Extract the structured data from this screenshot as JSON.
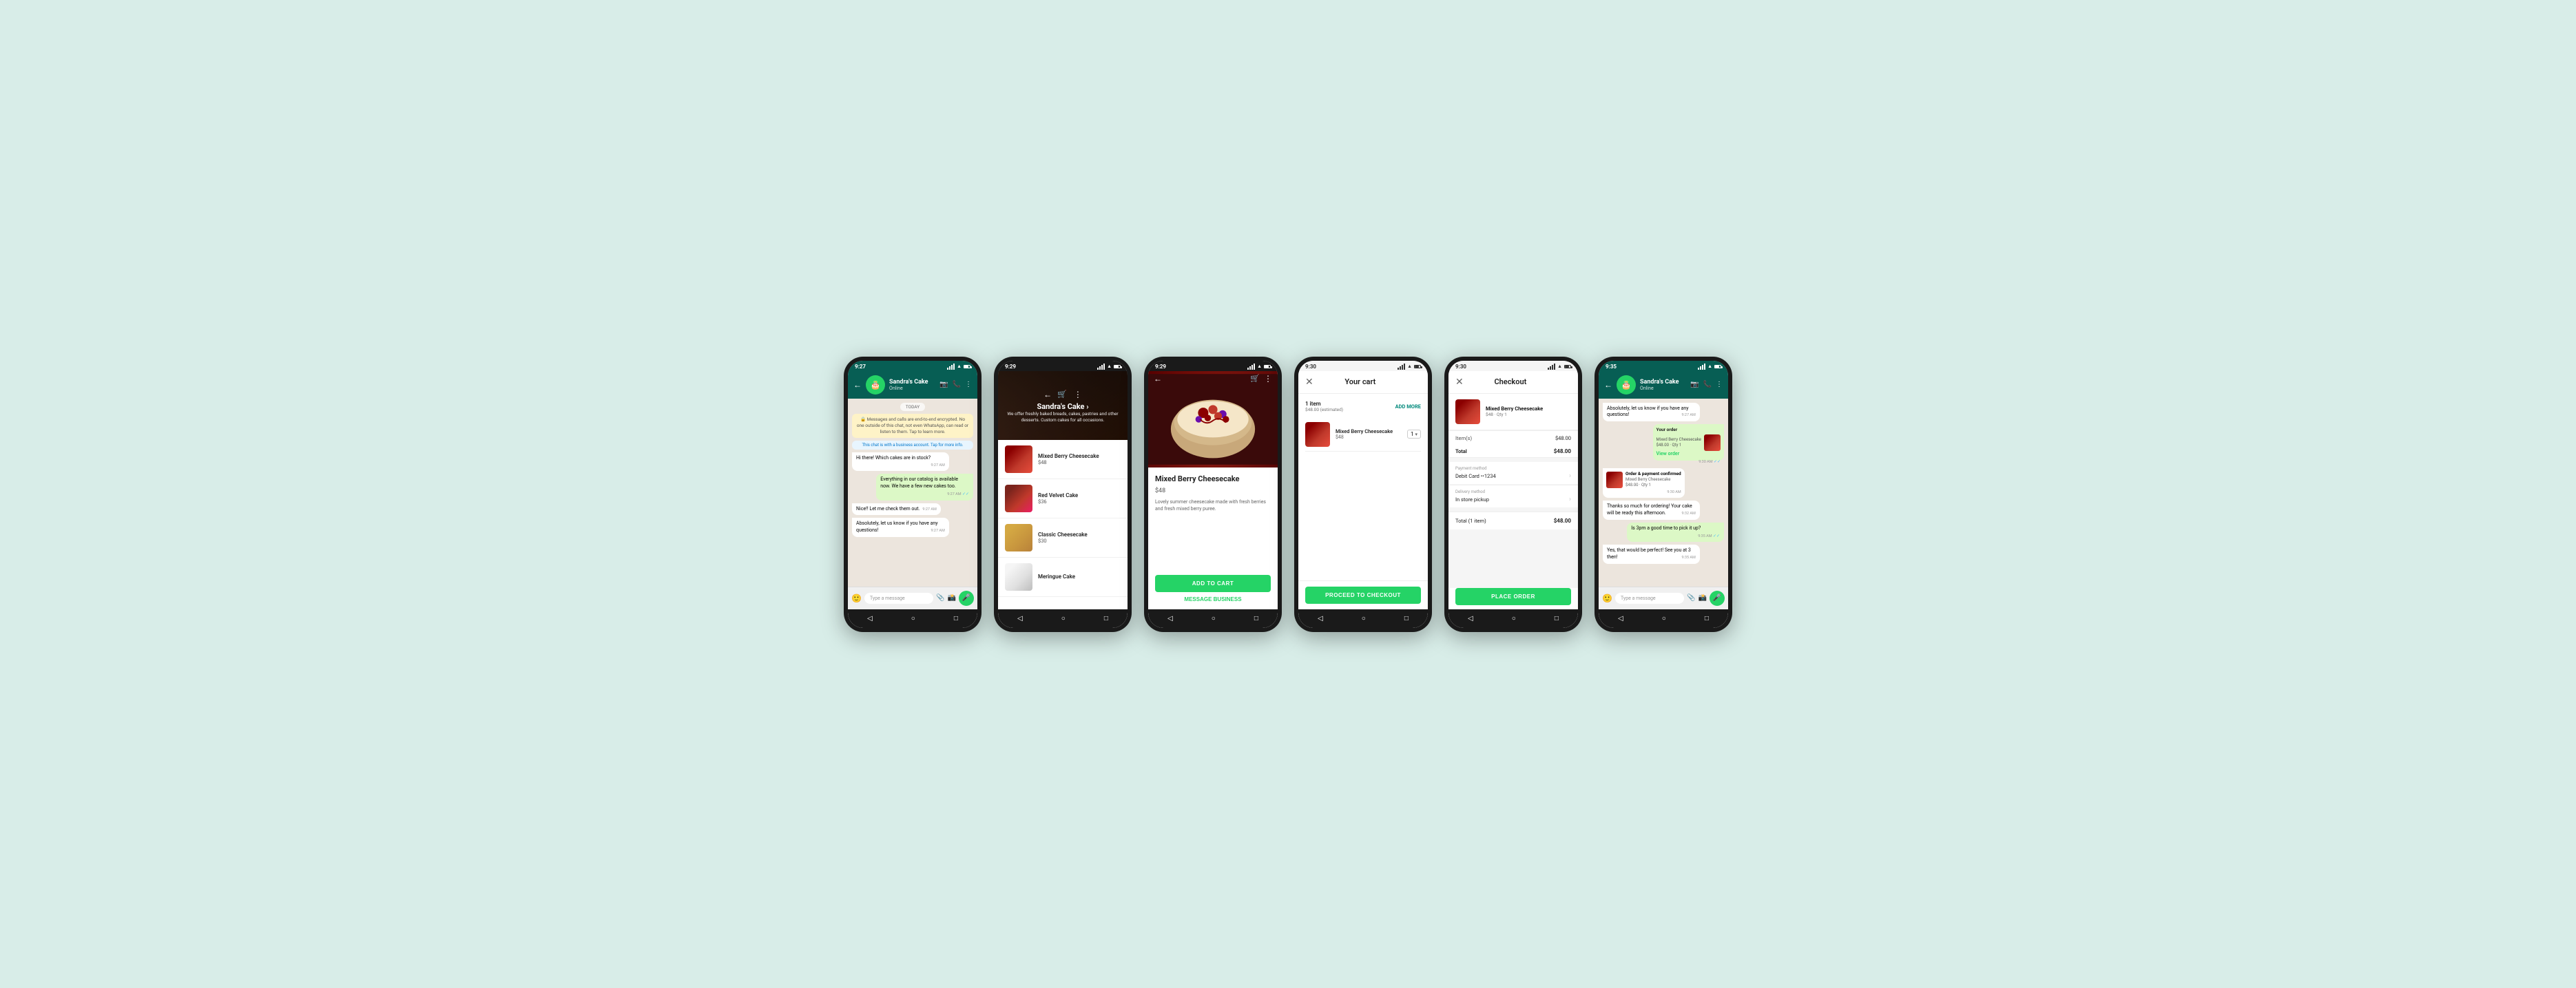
{
  "background": "#d8ede8",
  "phones": [
    {
      "id": "phone1",
      "type": "chat",
      "time": "9:27",
      "header": {
        "title": "Sandra's Cake",
        "status": "Online",
        "icons": [
          "📷",
          "📞",
          "⋮"
        ]
      },
      "messages": [
        {
          "type": "date",
          "text": "TODAY"
        },
        {
          "type": "system",
          "text": "🔒 Messages and calls are end-to-end encrypted. No one outside of this chat, not even WhatsApp, can read or listen to them. Tap to learn more."
        },
        {
          "type": "notice",
          "text": "This chat is with a business account. Tap for more info."
        },
        {
          "type": "received",
          "text": "Hi there! Which cakes are in stock?",
          "time": "9:27 AM"
        },
        {
          "type": "sent",
          "text": "Everything in our catalog is available now. We have a few new cakes too.",
          "time": "9:27 AM"
        },
        {
          "type": "received",
          "text": "Nice!! Let me check them out.",
          "time": "9:27 AM"
        },
        {
          "type": "received",
          "text": "Absolutely, let us know if you have any questions!",
          "time": "9:27 AM"
        }
      ],
      "input_placeholder": "Type a message"
    },
    {
      "id": "phone2",
      "type": "catalog",
      "time": "9:29",
      "store": {
        "name": "Sandra's Cake ›",
        "subtitle": "We offer freshly baked breads, cakes, pastries and other desserts. Custom cakes for all occasions."
      },
      "items": [
        {
          "name": "Mixed Berry Cheesecake",
          "price": "$48"
        },
        {
          "name": "Red Velvet Cake",
          "price": "$36"
        },
        {
          "name": "Classic Cheesecake",
          "price": "$30"
        },
        {
          "name": "Meringue Cake",
          "price": ""
        }
      ]
    },
    {
      "id": "phone3",
      "type": "product",
      "time": "9:29",
      "product": {
        "name": "Mixed Berry Cheesecake",
        "price": "$48",
        "description": "Lovely summer cheesecake made with fresh berries and fresh mixed berry puree."
      },
      "buttons": {
        "add_to_cart": "ADD TO CART",
        "message_business": "MESSAGE BUSINESS"
      }
    },
    {
      "id": "phone4",
      "type": "cart",
      "time": "9:30",
      "cart": {
        "title": "Your cart",
        "item_count": "1 item",
        "estimated": "$48.00 (estimated)",
        "add_more": "ADD MORE",
        "item": {
          "name": "Mixed Berry Cheesecake",
          "price": "$48",
          "qty": "1"
        },
        "proceed_button": "PROCEED TO CHECKOUT"
      }
    },
    {
      "id": "phone5",
      "type": "checkout",
      "time": "9:30",
      "checkout": {
        "title": "Checkout",
        "item": {
          "name": "Mixed Berry Cheesecake",
          "sub": "$48 · Qty 1"
        },
        "items_total_label": "Item(s)",
        "items_total": "$48.00",
        "total_label": "Total",
        "total": "$48.00",
        "payment_method_label": "Payment method",
        "payment_method": "Debit Card ••1234",
        "delivery_method_label": "Delivery method",
        "delivery_method": "In store pickup",
        "grand_total_label": "Total (1 item)",
        "grand_total": "$48.00",
        "place_order": "PLACE ORDER"
      }
    },
    {
      "id": "phone6",
      "type": "final_chat",
      "time": "9:35",
      "header": {
        "title": "Sandra's Cake",
        "status": "Online"
      },
      "messages": [
        {
          "type": "received",
          "text": "Absolutely, let us know if you have any questions!",
          "time": "9:27 AM"
        },
        {
          "type": "order_card",
          "time": "9:30 AM"
        },
        {
          "type": "received",
          "text": "Order & payment confirmed",
          "detail": "Mixed Berry Cheesecake\n$48.00 · Qty 1",
          "time": "9:30 AM"
        },
        {
          "type": "received",
          "text": "Thanks so much for ordering! Your cake will be ready this afternoon.",
          "time": "9:32 AM"
        },
        {
          "type": "sent",
          "text": "Is 3pm a good time to pick it up?",
          "time": "9:35 AM"
        },
        {
          "type": "received",
          "text": "Yes, that would be perfect! See you at 3 then!",
          "time": "9:35 AM"
        }
      ],
      "input_placeholder": "Type a message"
    }
  ]
}
